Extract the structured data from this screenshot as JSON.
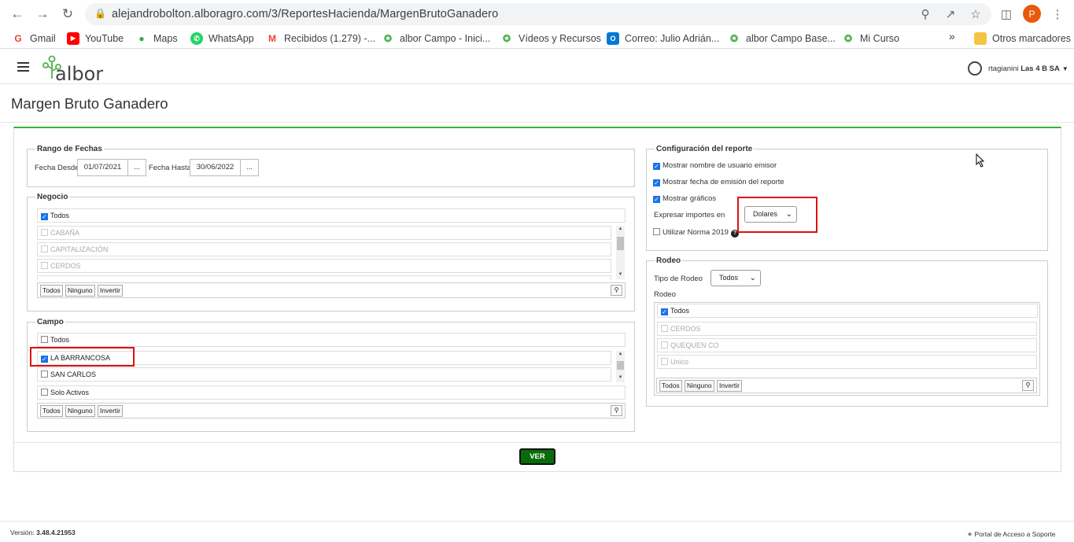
{
  "browser": {
    "url": "alejandrobolton.alboragro.com/3/ReportesHacienda/MargenBrutoGanadero",
    "profile_initial": "P",
    "bookmarks": [
      "Gmail",
      "YouTube",
      "Maps",
      "WhatsApp",
      "Recibidos (1.279) -...",
      "albor Campo - Inici...",
      "Vídeos y Recursos",
      "Correo: Julio Adrián...",
      "albor Campo Base...",
      "Mi Curso"
    ],
    "more": "»",
    "other_bookmarks": "Otros marcadores"
  },
  "app": {
    "logo_text": "albor",
    "user_name": "rtagianini",
    "company": "Las 4 B SA",
    "page_title": "Margen Bruto Ganadero"
  },
  "fechas": {
    "legend": "Rango de Fechas",
    "desde_label": "Fecha Desde",
    "desde_value": "01/07/2021",
    "hasta_label": "Fecha Hasta",
    "hasta_value": "30/06/2022",
    "picker": "..."
  },
  "negocio": {
    "legend": "Negocio",
    "all": "Todos",
    "items": [
      "CABAÑA",
      "CAPITALIZACIÓN",
      "CERDOS"
    ],
    "actions": [
      "Todos",
      "Ninguno",
      "Invertir"
    ]
  },
  "campo": {
    "legend": "Campo",
    "all": "Todos",
    "items": [
      "LA BARRANCOSA",
      "SAN CARLOS"
    ],
    "solo_activos": "Solo Activos",
    "actions": [
      "Todos",
      "Ninguno",
      "Invertir"
    ]
  },
  "config": {
    "legend": "Configuración del reporte",
    "opt1": "Mostrar nombre de usuario emisor",
    "opt2": "Mostrar fecha de emisión del reporte",
    "opt3": "Mostrar gráficos",
    "expresar_label": "Expresar importes en",
    "expresar_value": "Dolares",
    "norma": "Utilizar Norma 2019"
  },
  "rodeo": {
    "legend": "Rodeo",
    "tipo_label": "Tipo de Rodeo",
    "tipo_value": "Todos",
    "rodeo_label": "Rodeo",
    "all": "Todos",
    "items": [
      "CERDOS",
      "QUEQUEN CO",
      "Unico"
    ],
    "actions": [
      "Todos",
      "Ninguno",
      "Invertir"
    ]
  },
  "ver_button": "VER",
  "footer": {
    "version_label": "Versión:",
    "version_value": "3.48.4.21953",
    "support": "Portal de Acceso a Soporte"
  },
  "colors": {
    "accent_green": "#2eb82e",
    "ver_green": "#0a6b0a",
    "highlight_red": "#e01010",
    "checkbox_blue": "#1a73e8"
  }
}
